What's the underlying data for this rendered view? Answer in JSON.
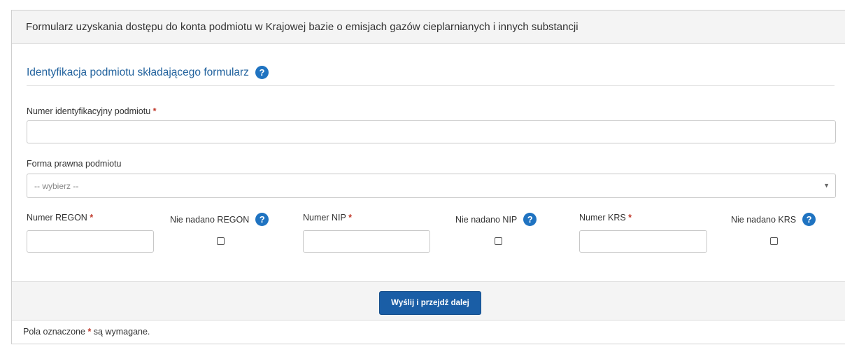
{
  "panel": {
    "title": "Formularz uzyskania dostępu do konta podmiotu w Krajowej bazie o emisjach gazów cieplarnianych i innych substancji"
  },
  "section": {
    "title": "Identyfikacja podmiotu składającego formularz",
    "help": "?"
  },
  "fields": {
    "id_number": {
      "label": "Numer identyfikacyjny podmiotu",
      "required": "*",
      "value": ""
    },
    "legal_form": {
      "label": "Forma prawna podmiotu",
      "selected": "-- wybierz --",
      "caret": "▼"
    },
    "regon": {
      "label": "Numer REGON",
      "required": "*",
      "value": ""
    },
    "no_regon": {
      "label": "Nie nadano REGON",
      "help": "?"
    },
    "nip": {
      "label": "Numer NIP",
      "required": "*",
      "value": ""
    },
    "no_nip": {
      "label": "Nie nadano NIP",
      "help": "?"
    },
    "krs": {
      "label": "Numer KRS",
      "required": "*",
      "value": ""
    },
    "no_krs": {
      "label": "Nie nadano KRS",
      "help": "?"
    }
  },
  "actions": {
    "submit_label": "Wyślij i przejdź dalej"
  },
  "footer": {
    "note_before": "Pola oznaczone",
    "note_star": "*",
    "note_after": "są wymagane."
  },
  "colors": {
    "accent": "#1a5ea6",
    "section_title": "#23639e",
    "required": "#c0392b",
    "header_bg": "#f4f4f4"
  }
}
